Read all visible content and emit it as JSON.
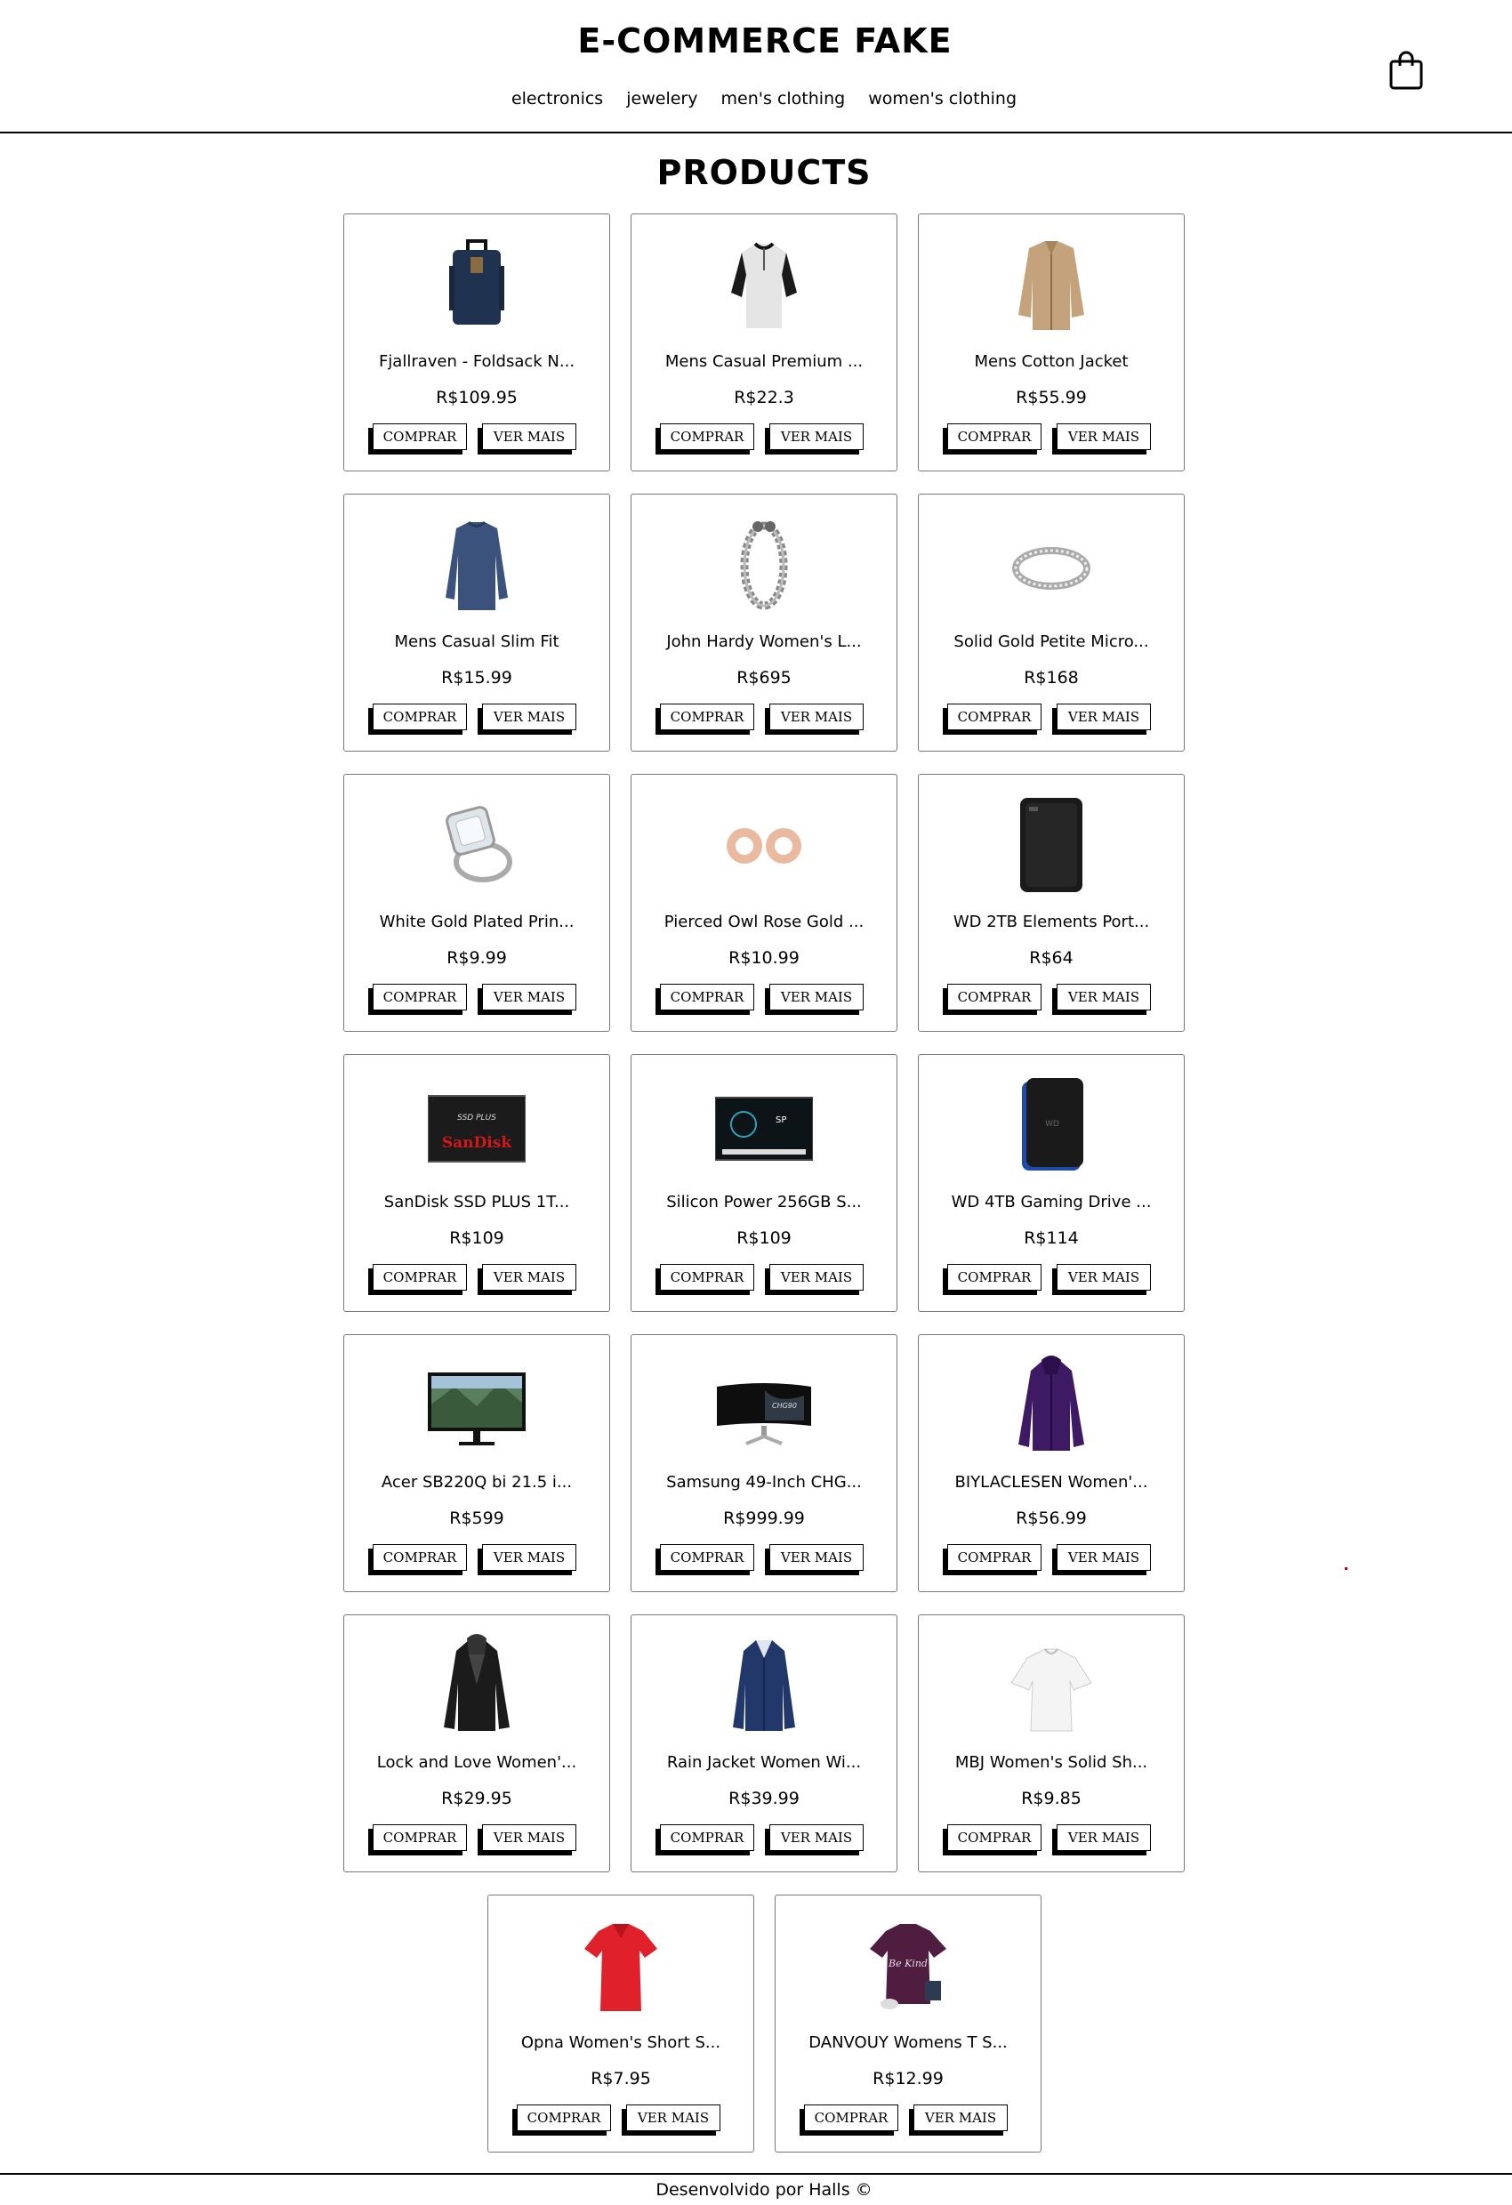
{
  "header": {
    "title": "E-COMMERCE FAKE",
    "nav": [
      "electronics",
      "jewelery",
      "men's clothing",
      "women's clothing"
    ],
    "cart_icon": "shopping-bag-icon"
  },
  "main": {
    "heading": "PRODUCTS",
    "buy_label": "COMPRAR",
    "more_label": "VER MAIS",
    "products": [
      {
        "name": "Fjallraven - Foldsack N...",
        "price": "R$109.95",
        "icon": "backpack"
      },
      {
        "name": "Mens Casual Premium ...",
        "price": "R$22.3",
        "icon": "henley-shirt"
      },
      {
        "name": "Mens Cotton Jacket",
        "price": "R$55.99",
        "icon": "cotton-jacket"
      },
      {
        "name": "Mens Casual Slim Fit",
        "price": "R$15.99",
        "icon": "slim-fit-shirt"
      },
      {
        "name": "John Hardy Women's L...",
        "price": "R$695",
        "icon": "chain-bracelet"
      },
      {
        "name": "Solid Gold Petite Micro...",
        "price": "R$168",
        "icon": "band-ring"
      },
      {
        "name": "White Gold Plated Prin...",
        "price": "R$9.99",
        "icon": "diamond-ring"
      },
      {
        "name": "Pierced Owl Rose Gold ...",
        "price": "R$10.99",
        "icon": "rose-gold-plugs"
      },
      {
        "name": "WD 2TB Elements Port...",
        "price": "R$64",
        "icon": "portable-drive"
      },
      {
        "name": "SanDisk SSD PLUS 1T...",
        "price": "R$109",
        "icon": "ssd"
      },
      {
        "name": "Silicon Power 256GB S...",
        "price": "R$109",
        "icon": "ssd-dark"
      },
      {
        "name": "WD 4TB Gaming Drive ...",
        "price": "R$114",
        "icon": "gaming-drive"
      },
      {
        "name": "Acer SB220Q bi 21.5 i...",
        "price": "R$599",
        "icon": "monitor"
      },
      {
        "name": "Samsung 49-Inch CHG...",
        "price": "R$999.99",
        "icon": "curved-monitor"
      },
      {
        "name": "BIYLACLESEN Women'...",
        "price": "R$56.99",
        "icon": "purple-jacket"
      },
      {
        "name": "Lock and Love Women'...",
        "price": "R$29.95",
        "icon": "leather-jacket"
      },
      {
        "name": "Rain Jacket Women Wi...",
        "price": "R$39.99",
        "icon": "rain-jacket"
      },
      {
        "name": "MBJ Women's Solid Sh...",
        "price": "R$9.85",
        "icon": "white-top"
      },
      {
        "name": "Opna Women's Short S...",
        "price": "R$7.95",
        "icon": "red-tshirt"
      },
      {
        "name": "DANVOUY Womens T S...",
        "price": "R$12.99",
        "icon": "purple-tshirt"
      }
    ]
  },
  "footer": {
    "text": "Desenvolvido por Halls ©"
  }
}
